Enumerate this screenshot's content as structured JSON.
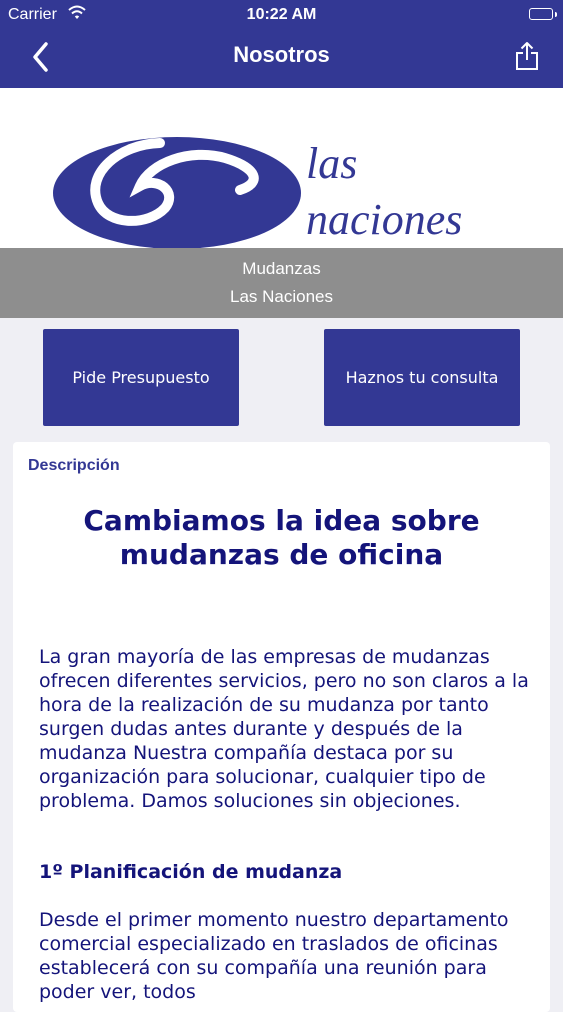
{
  "status_bar": {
    "carrier": "Carrier",
    "time": "10:22 AM"
  },
  "nav": {
    "title": "Nosotros"
  },
  "logo": {
    "line1": "las",
    "line2": "naciones"
  },
  "banner": {
    "line1": "Mudanzas",
    "line2": "Las Naciones"
  },
  "buttons": {
    "quote_label": "Pide Presupuesto",
    "contact_label": "Haznos tu consulta"
  },
  "content": {
    "label": "Descripción",
    "headline_line1": "Cambiamos la idea sobre",
    "headline_line2": "mudanzas de oficina",
    "paragraph1": "La gran mayoría de las empresas de mudanzas ofrecen diferentes servicios, pero no son claros a la hora de la realización de su mudanza por tanto surgen dudas antes durante y después de la mudanza  Nuestra compañía destaca por su organización para solucionar, cualquier tipo de problema. Damos soluciones sin objeciones.",
    "section1_title": "1º Planificación de mudanza",
    "paragraph2": "Desde el primer momento nuestro departamento comercial especializado en traslados de oficinas establecerá  con su compañía una reunión para poder ver, todos"
  },
  "colors": {
    "brand": "#333894",
    "band": "#8e8e8e",
    "text": "#14147a"
  }
}
